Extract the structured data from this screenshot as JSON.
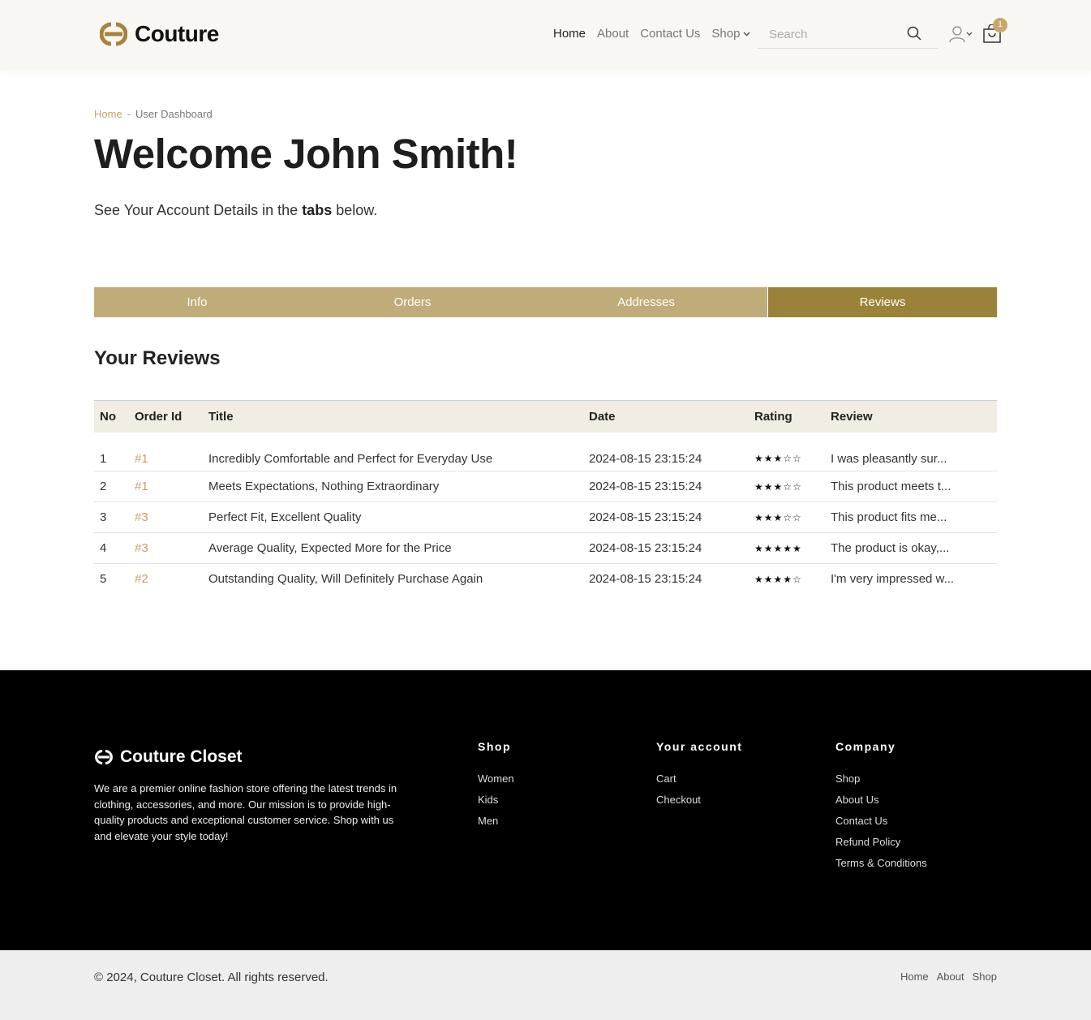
{
  "header": {
    "brand": "Couture",
    "nav": [
      {
        "label": "Home",
        "active": true
      },
      {
        "label": "About",
        "active": false
      },
      {
        "label": "Contact Us",
        "active": false
      }
    ],
    "shop_label": "Shop",
    "search_placeholder": "Search",
    "cart_count": "1",
    "icons": [
      "search-icon",
      "user-icon",
      "chevron-down-icon",
      "cart-icon"
    ]
  },
  "breadcrumb": {
    "home": "Home",
    "separator": "-",
    "current": "User Dashboard"
  },
  "title": "Welcome John Smith!",
  "subtitle": {
    "before": "See Your Account Details in the ",
    "bold": "tabs",
    "after": " below."
  },
  "tabs": [
    "Info",
    "Orders",
    "Addresses",
    "Reviews"
  ],
  "active_tab": "Reviews",
  "section_title": "Your Reviews",
  "table": {
    "headers": [
      "No",
      "Order Id",
      "Title",
      "Date",
      "Rating",
      "Review"
    ],
    "rows": [
      {
        "no": "1",
        "order": "#1",
        "title": "Incredibly Comfortable and Perfect for Everyday Use",
        "date": "2024-08-15 23:15:24",
        "rating": "★★★☆☆",
        "review": "I was pleasantly sur..."
      },
      {
        "no": "2",
        "order": "#1",
        "title": "Meets Expectations, Nothing Extraordinary",
        "date": "2024-08-15 23:15:24",
        "rating": "★★★☆☆",
        "review": "This product meets t..."
      },
      {
        "no": "3",
        "order": "#3",
        "title": "Perfect Fit, Excellent Quality",
        "date": "2024-08-15 23:15:24",
        "rating": "★★★☆☆",
        "review": "This product fits me..."
      },
      {
        "no": "4",
        "order": "#3",
        "title": "Average Quality, Expected More for the Price",
        "date": "2024-08-15 23:15:24",
        "rating": "★★★★★",
        "review": "The product is okay,..."
      },
      {
        "no": "5",
        "order": "#2",
        "title": "Outstanding Quality, Will Definitely Purchase Again",
        "date": "2024-08-15 23:15:24",
        "rating": "★★★★☆",
        "review": "I'm very impressed w..."
      }
    ]
  },
  "footer": {
    "brand": "Couture Closet",
    "about": "We are a premier online fashion store offering the latest trends in clothing, accessories, and more. Our mission is to provide high-quality products and exceptional customer service. Shop with us and elevate your style today!",
    "columns": [
      {
        "heading": "Shop",
        "links": [
          "Women",
          "Kids",
          "Men"
        ]
      },
      {
        "heading": "Your account",
        "links": [
          "Cart",
          "Checkout"
        ]
      },
      {
        "heading": "Company",
        "links": [
          "Shop",
          "About Us",
          "Contact Us",
          "Refund Policy",
          "Terms & Conditions"
        ]
      }
    ],
    "copyright": "© 2024, Couture Closet. All rights reserved.",
    "bottom_links": [
      "Home",
      "About",
      "Shop"
    ]
  },
  "colors": {
    "accent": "#c0a46a",
    "tab": "#bfac78",
    "tab_active": "#9a8339",
    "footer_bg": "#000000"
  }
}
